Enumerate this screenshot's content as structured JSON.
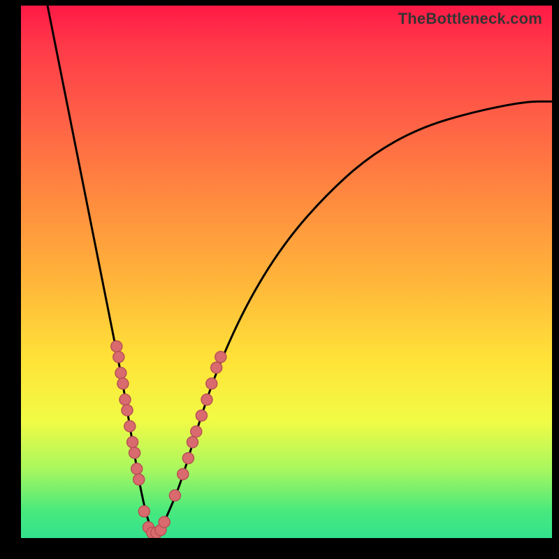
{
  "watermark": "TheBottleneck.com",
  "chart_data": {
    "type": "line",
    "title": "",
    "xlabel": "",
    "ylabel": "",
    "xlim": [
      0,
      100
    ],
    "ylim": [
      0,
      100
    ],
    "series": [
      {
        "name": "curve",
        "x": [
          5,
          8,
          12,
          15,
          17,
          19,
          20,
          21,
          22,
          23,
          24,
          25,
          26,
          27,
          30,
          33,
          37,
          43,
          50,
          58,
          66,
          75,
          85,
          95,
          100
        ],
        "y": [
          100,
          85,
          65,
          50,
          40,
          30,
          24,
          18,
          12,
          7,
          3,
          1,
          1,
          3,
          10,
          20,
          32,
          45,
          56,
          65,
          72,
          77,
          80,
          82,
          82
        ]
      }
    ],
    "scatter_points": {
      "name": "dots",
      "comment": "Clustered points along both arms near the valley and the floor",
      "points": [
        {
          "x": 18.0,
          "y": 36
        },
        {
          "x": 18.4,
          "y": 34
        },
        {
          "x": 18.8,
          "y": 31
        },
        {
          "x": 19.2,
          "y": 29
        },
        {
          "x": 19.6,
          "y": 26
        },
        {
          "x": 20.0,
          "y": 24
        },
        {
          "x": 20.5,
          "y": 21
        },
        {
          "x": 21.0,
          "y": 18
        },
        {
          "x": 21.4,
          "y": 16
        },
        {
          "x": 21.8,
          "y": 13
        },
        {
          "x": 22.2,
          "y": 11
        },
        {
          "x": 23.2,
          "y": 5
        },
        {
          "x": 24.0,
          "y": 2
        },
        {
          "x": 24.7,
          "y": 1
        },
        {
          "x": 25.5,
          "y": 1
        },
        {
          "x": 26.3,
          "y": 1.5
        },
        {
          "x": 27.0,
          "y": 3
        },
        {
          "x": 29.0,
          "y": 8
        },
        {
          "x": 30.5,
          "y": 12
        },
        {
          "x": 31.5,
          "y": 15
        },
        {
          "x": 32.3,
          "y": 18
        },
        {
          "x": 33.0,
          "y": 20
        },
        {
          "x": 34.0,
          "y": 23
        },
        {
          "x": 35.0,
          "y": 26
        },
        {
          "x": 35.9,
          "y": 29
        },
        {
          "x": 36.8,
          "y": 32
        },
        {
          "x": 37.6,
          "y": 34
        }
      ]
    },
    "background_gradient": {
      "top": "#ff1946",
      "mid_high": "#ff8a3f",
      "mid": "#ffe438",
      "mid_low": "#a9f75e",
      "bottom": "#32e28e"
    }
  }
}
